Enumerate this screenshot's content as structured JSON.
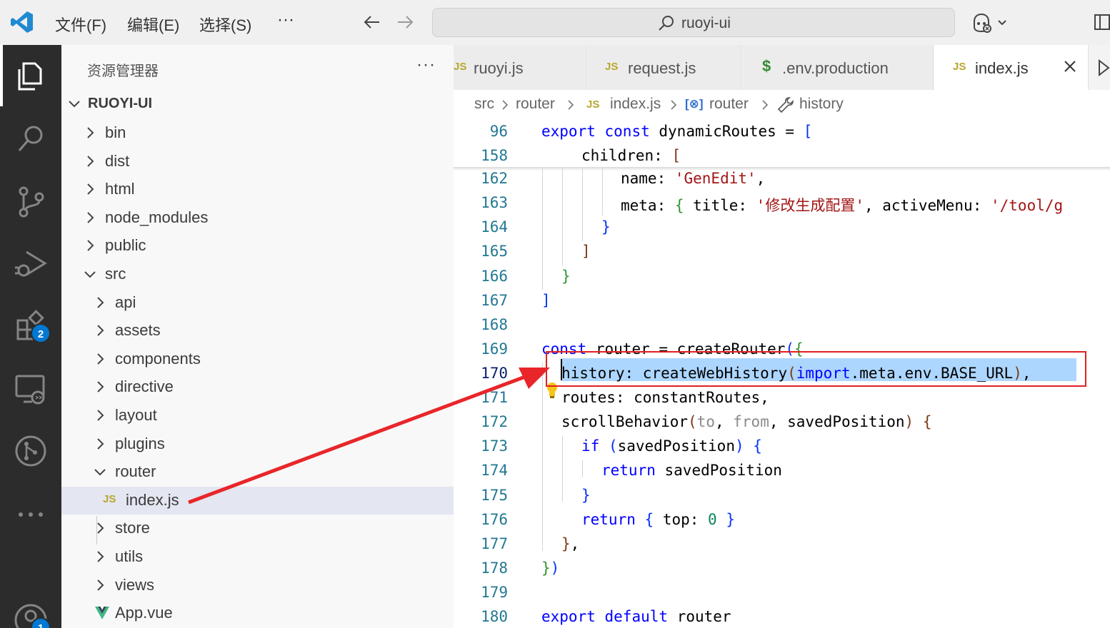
{
  "titlebar": {
    "menus": [
      "文件(F)",
      "编辑(E)",
      "选择(S)"
    ],
    "more": "···",
    "search_text": "ruoyi-ui"
  },
  "activity": {
    "extensions_badge": "2",
    "accounts_badge": "1"
  },
  "explorer": {
    "title": "资源管理器",
    "more": "···",
    "root": "RUOYI-UI",
    "items": {
      "bin": "bin",
      "dist": "dist",
      "html": "html",
      "node_modules": "node_modules",
      "public": "public",
      "src": "src",
      "api": "api",
      "assets": "assets",
      "components": "components",
      "directive": "directive",
      "layout": "layout",
      "plugins": "plugins",
      "router": "router",
      "index_js": "index.js",
      "store": "store",
      "utils": "utils",
      "views": "views",
      "app_vue": "App.vue"
    },
    "js_icon": "JS",
    "vue_icon": "V"
  },
  "tabs": [
    {
      "icon": "JS",
      "label": "ruoyi.js"
    },
    {
      "icon": "JS",
      "label": "request.js"
    },
    {
      "icon": "$",
      "label": ".env.production"
    },
    {
      "icon": "JS",
      "label": "index.js"
    }
  ],
  "breadcrumb": {
    "src": "src",
    "router": "router",
    "js_icon": "JS",
    "file": "index.js",
    "var_icon": "[⊗]",
    "symbol": "router",
    "prop": "history"
  },
  "code": {
    "lines": {
      "n96": "96",
      "n158": "158",
      "n162": "162",
      "n163": "163",
      "n164": "164",
      "n165": "165",
      "n166": "166",
      "n167": "167",
      "n168": "168",
      "n169": "169",
      "n170": "170",
      "n171": "171",
      "n172": "172",
      "n173": "173",
      "n174": "174",
      "n175": "175",
      "n176": "176",
      "n177": "177",
      "n178": "178",
      "n179": "179",
      "n180": "180"
    },
    "t": {
      "export": "export",
      "const": "const",
      "dynamicRoutes": "dynamicRoutes",
      "eq_bracket": " = ",
      "open_sq": "[",
      "children": "children: ",
      "name": "name: ",
      "genedit": "'GenEdit'",
      "comma": ",",
      "meta": "meta: ",
      "open_curly": "{",
      "title": " title: ",
      "title_val": "'修改生成配置'",
      "activeMenu": " activeMenu: ",
      "active_val": "'/tool/g",
      "close_curly": "}",
      "close_sq": "]",
      "router": "router",
      "eq": " = ",
      "createRouter": "createRouter",
      "open_paren": "(",
      "history": "history: ",
      "createWebHistory": "createWebHistory",
      "import_kw": "import",
      "meta_env": ".meta.env.BASE_URL",
      "close_paren": ")",
      "routes": "routes: constantRoutes,",
      "scrollBehavior": "scrollBehavior",
      "to": "to",
      "from": "from",
      "savedPosition": "savedPosition",
      "if_kw": "if",
      "return_kw": "return",
      "top": " top: ",
      "zero": "0",
      "default_kw": "default",
      "sep": ", "
    }
  }
}
